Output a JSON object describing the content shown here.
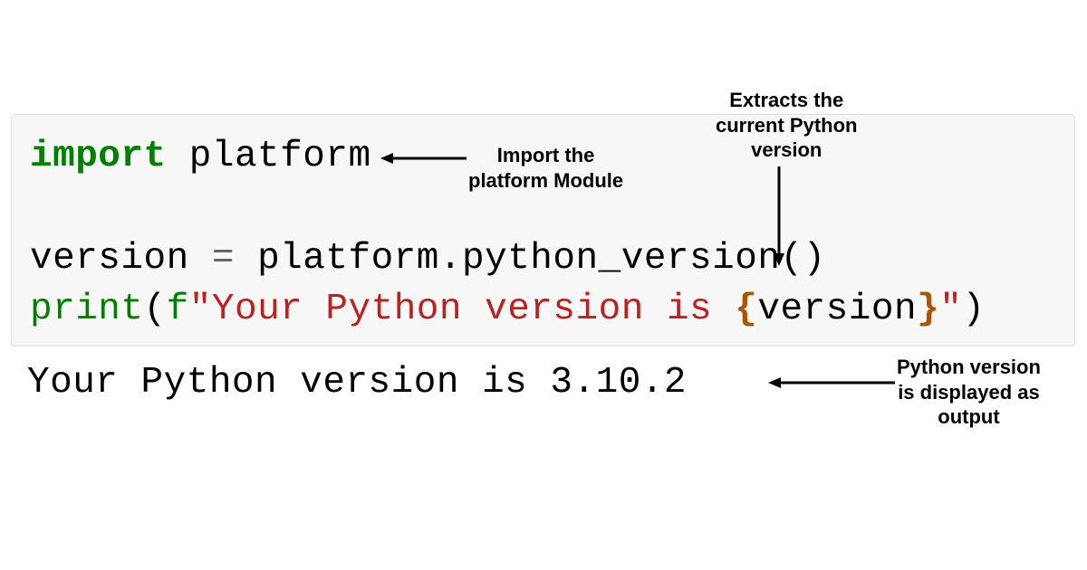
{
  "code": {
    "line1": {
      "keyword": "import",
      "module": "platform"
    },
    "line2": {
      "var": "version",
      "operator": "=",
      "call": "platform.python_version()"
    },
    "line3": {
      "func": "print",
      "open_paren": "(",
      "fprefix": "f",
      "quote1": "\"",
      "text": "Your Python version is ",
      "brace_open": "{",
      "var": "version",
      "brace_close": "}",
      "quote2": "\"",
      "close_paren": ")"
    }
  },
  "output": {
    "text": "Your Python version is 3.10.2"
  },
  "annotations": {
    "a1": "Import the\nplatform Module",
    "a2": "Extracts the\ncurrent Python\nversion",
    "a3": "Python version\nis displayed as\noutput"
  }
}
